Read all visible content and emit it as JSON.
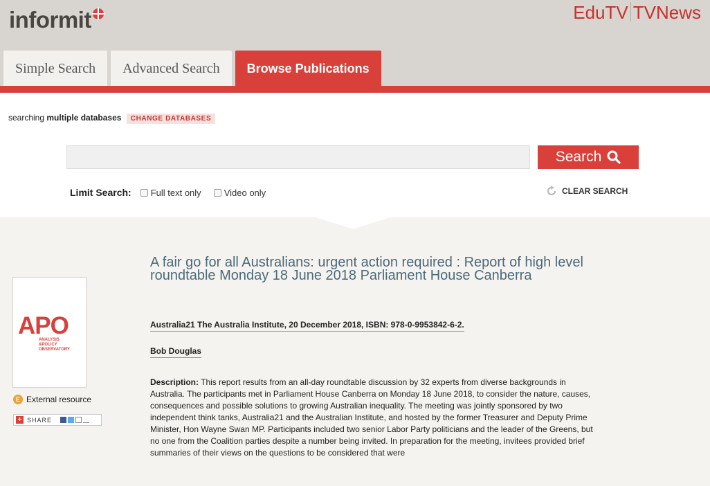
{
  "header": {
    "logo_text": "informit",
    "links": [
      "EduTV",
      "TVNews"
    ]
  },
  "tabs": [
    {
      "label": "Simple Search",
      "active": false
    },
    {
      "label": "Advanced Search",
      "active": false
    },
    {
      "label": "Browse Publications",
      "active": true
    }
  ],
  "search": {
    "db_prefix": "searching",
    "db_bold": "multiple databases",
    "change_label": "CHANGE DATABASES",
    "query": "",
    "button_label": "Search",
    "limit_label": "Limit Search:",
    "options": [
      {
        "label": "Full text only",
        "checked": false
      },
      {
        "label": "Video only",
        "checked": false
      }
    ],
    "clear_label": "CLEAR SEARCH"
  },
  "result": {
    "cover_logo": "APO",
    "cover_sub": [
      "ANALYSIS",
      "&POLICY",
      "OBSERVATORY"
    ],
    "external_badge": "E",
    "external_label": "External resource",
    "share_label": "SHARE",
    "title": "A fair go for all Australians: urgent action required : Report of high level roundtable Monday 18 June 2018 Parliament House Canberra",
    "meta": "Australia21 The Australia Institute, 20 December 2018, ISBN: 978-0-9953842-6-2.",
    "author": "Bob Douglas",
    "description_label": "Description:",
    "description": "This report results from an all-day roundtable discussion by 32 experts from diverse backgrounds in Australia. The participants met in Parliament House Canberra on Monday 18 June 2018, to consider the nature, causes, consequences and possible solutions to growing Australian inequality. The meeting was jointly sponsored by two independent think tanks, Australia21 and the Australian Institute, and hosted by the former Treasurer and Deputy Prime Minister, Hon Wayne Swan MP. Participants included two senior Labor Party politicians and the leader of the Greens, but no one from the Coalition parties despite a number being invited. In preparation for the meeting, invitees provided brief summaries of their views on the questions to be considered that were"
  },
  "colors": {
    "accent": "#d9403a",
    "header_bg": "#d8d4cf",
    "title": "#4a6a7a"
  }
}
